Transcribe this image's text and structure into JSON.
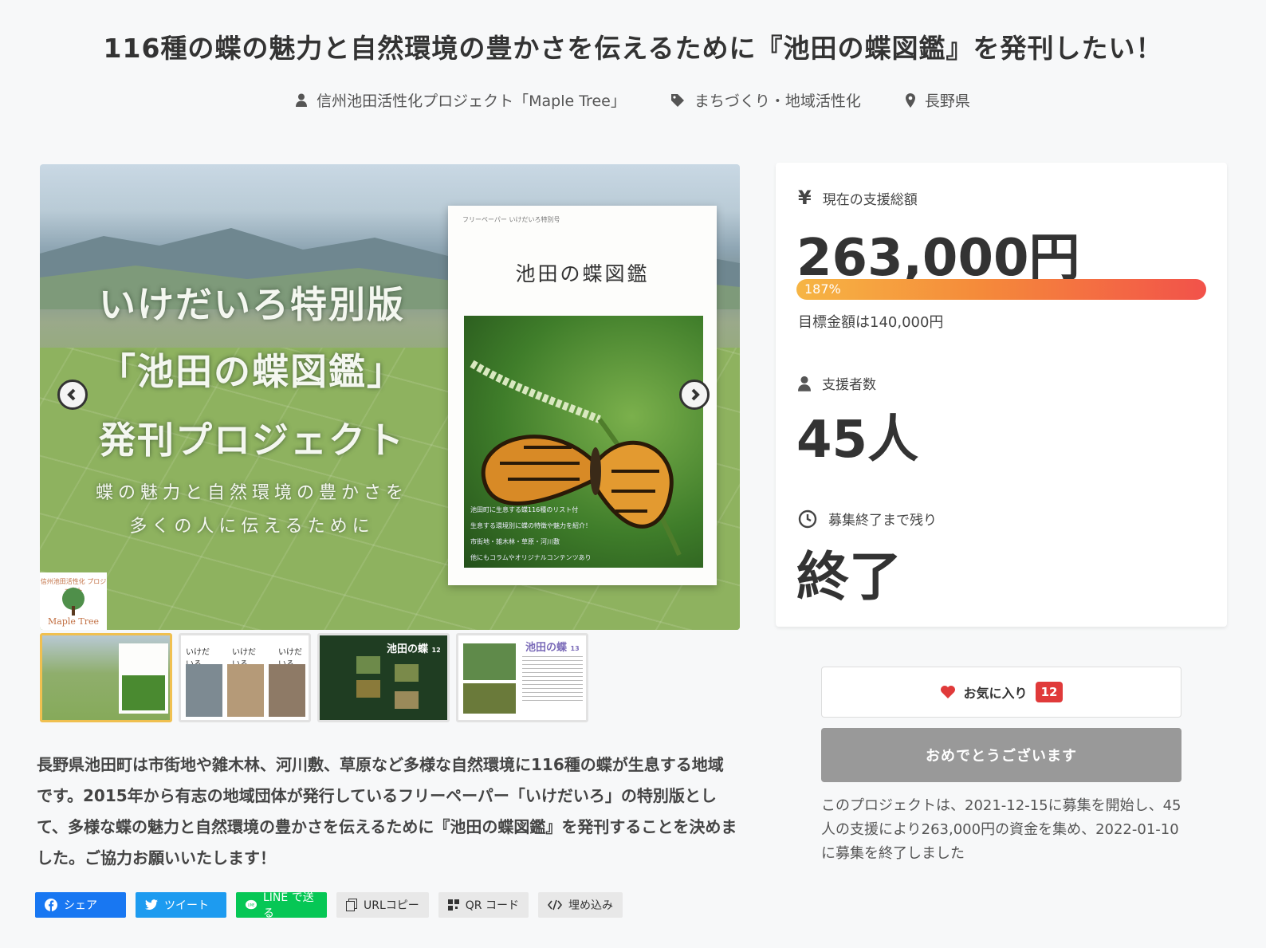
{
  "header": {
    "title": "116種の蝶の魅力と自然環境の豊かさを伝えるために『池田の蝶図鑑』を発刊したい！",
    "owner": "信州池田活性化プロジェクト「Maple Tree」",
    "category": "まちづくり・地域活性化",
    "location": "長野県"
  },
  "hero": {
    "line1": "いけだいろ特別版",
    "line2": "「池田の蝶図鑑」",
    "line3": "発刊プロジェクト",
    "sub1": "蝶の魅力と自然環境の豊かさを",
    "sub2": "多くの人に伝えるために",
    "book_small": "フリーペーパー いけだいろ特別号",
    "book_title": "池田の蝶図鑑",
    "book_captions": [
      "池田町に生息する蝶116種のリスト付",
      "生息する環境別に蝶の特徴や魅力を紹介！",
      "市街地・雑木林・草原・河川敷",
      "他にもコラムやオリジナルコンテンツあり"
    ],
    "logo_arc": "信州池田活性化 プロジェクト",
    "logo_text": "Maple Tree",
    "prev_icon": "chevron-left-icon",
    "next_icon": "chevron-right-icon"
  },
  "thumbnails": {
    "t2_labels": [
      "いけだいろ",
      "いけだいろ",
      "いけだいろ"
    ],
    "t3_title": "池田の蝶",
    "t3_page": "12",
    "t4_title": "池田の蝶",
    "t4_page": "13"
  },
  "description": "長野県池田町は市街地や雑木林、河川敷、草原など多様な自然環境に116種の蝶が生息する地域です。2015年から有志の地域団体が発行しているフリーペーパー「いけだいろ」の特別版として、多様な蝶の魅力と自然環境の豊かさを伝えるために『池田の蝶図鑑』を発刊することを決めました。ご協力お願いいたします！",
  "share": {
    "facebook": "シェア",
    "twitter": "ツイート",
    "line": "LINE で送る",
    "url_copy": "URLコピー",
    "qr": "QR コード",
    "embed": "埋め込み"
  },
  "stats": {
    "amount_label": "現在の支援総額",
    "amount": "263,000円",
    "percent_label": "187%",
    "percent": 187,
    "goal": "目標金額は140,000円",
    "backers_label": "支援者数",
    "backers": "45人",
    "remaining_label": "募集終了まで残り",
    "remaining": "終了"
  },
  "actions": {
    "favorite_label": "お気に入り",
    "favorite_count": "12",
    "done_label": "おめでとうございます"
  },
  "summary": "このプロジェクトは、2021-12-15に募集を開始し、45人の支援により263,000円の資金を集め、2022-01-10に募集を終了しました",
  "colors": {
    "progress_start": "#f6b544",
    "progress_end": "#f2524a",
    "favorite_badge": "#e03a3a",
    "facebook": "#1877f2",
    "twitter": "#1d9bf0",
    "line": "#06c755"
  }
}
